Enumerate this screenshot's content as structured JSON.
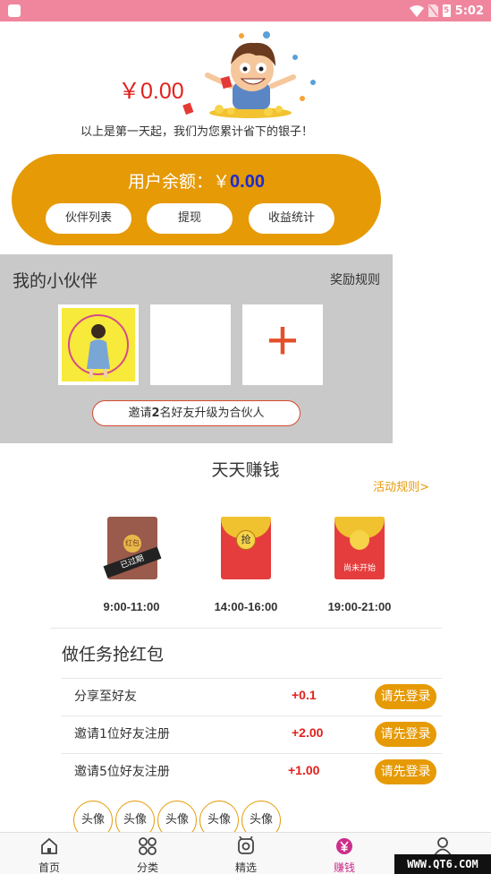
{
  "status_bar": {
    "time": "5:02",
    "battery": "5"
  },
  "savings": {
    "amount": "￥0.00",
    "caption": "以上是第一天起，我们为您累计省下的银子！"
  },
  "balance": {
    "label": "用户余额：￥",
    "value": "0.00",
    "buttons": [
      "伙伴列表",
      "提现",
      "收益统计"
    ]
  },
  "partner": {
    "title": "我的小伙伴",
    "rule_link": "奖励规则",
    "add_symbol": "+",
    "invite": {
      "pre": "邀请",
      "num": "2",
      "post": "名好友升级为合伙人"
    }
  },
  "daily": {
    "title": "天天赚钱",
    "rule_link": "活动规则>",
    "envelopes": [
      {
        "badge": "红包",
        "status": "已过期",
        "time": "9:00-11:00"
      },
      {
        "badge": "抢",
        "status": "",
        "time": "14:00-16:00"
      },
      {
        "badge": "",
        "status": "尚未开始",
        "time": "19:00-21:00"
      }
    ]
  },
  "tasks": {
    "title": "做任务抢红包",
    "items": [
      {
        "label": "分享至好友",
        "reward": "+0.1",
        "button": "请先登录"
      },
      {
        "label": "邀请1位好友注册",
        "reward": "+2.00",
        "button": "请先登录"
      },
      {
        "label": "邀请5位好友注册",
        "reward": "+1.00",
        "button": "请先登录"
      }
    ],
    "avatars": [
      "头像",
      "头像",
      "头像",
      "头像",
      "头像"
    ]
  },
  "nav": {
    "items": [
      {
        "label": "首页",
        "icon": "home-icon"
      },
      {
        "label": "分类",
        "icon": "grid-icon"
      },
      {
        "label": "精选",
        "icon": "featured-icon"
      },
      {
        "label": "赚钱",
        "icon": "money-icon"
      },
      {
        "label": "",
        "icon": "user-icon"
      }
    ],
    "active": "赚钱"
  },
  "watermark": "WWW.QT6.COM",
  "colors": {
    "accent": "#e59a06",
    "price_red": "#e3201b",
    "status_bar": "#f0869e",
    "nav_active": "#cc2e8a"
  }
}
